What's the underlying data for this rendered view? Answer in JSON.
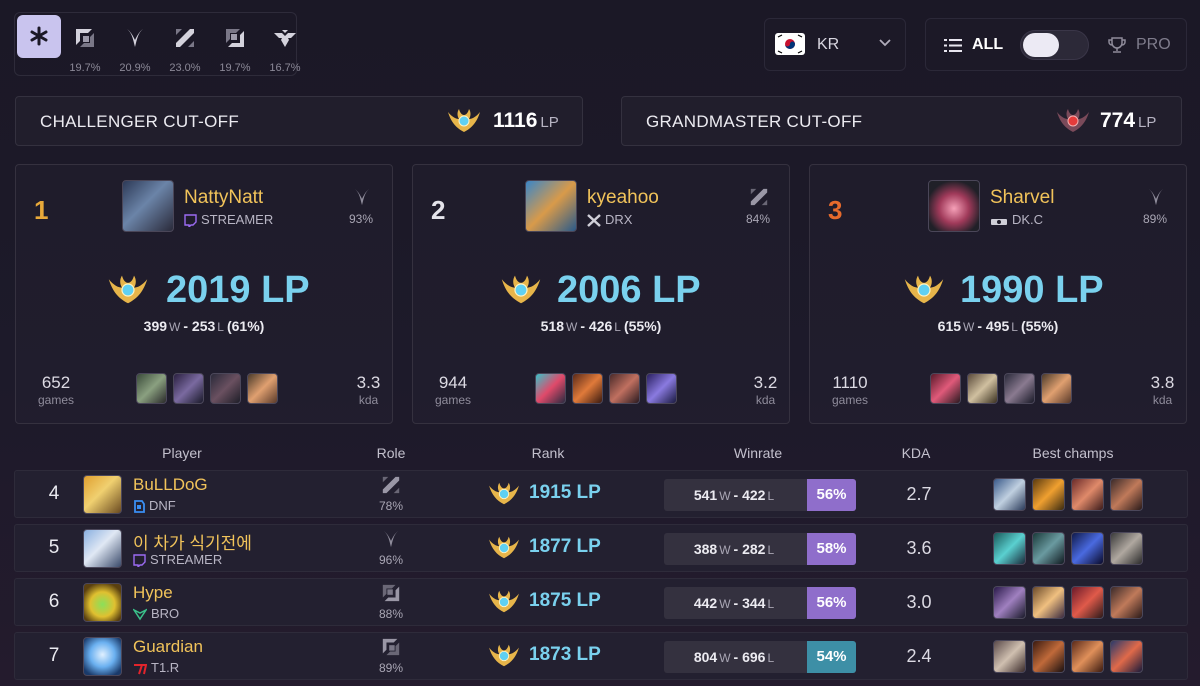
{
  "roles": [
    {
      "icon": "all-roles-icon",
      "pct": ""
    },
    {
      "icon": "top-lane-icon",
      "pct": "19.7%"
    },
    {
      "icon": "jungle-icon",
      "pct": "20.9%"
    },
    {
      "icon": "mid-lane-icon",
      "pct": "23.0%"
    },
    {
      "icon": "bot-lane-icon",
      "pct": "19.7%"
    },
    {
      "icon": "support-icon",
      "pct": "16.7%"
    }
  ],
  "region": {
    "label": "KR"
  },
  "modes": {
    "all": "ALL",
    "pro": "PRO"
  },
  "cutoffs": {
    "challenger": {
      "label": "CHALLENGER CUT-OFF",
      "value": "1116",
      "unit": "LP"
    },
    "grandmaster": {
      "label": "GRANDMASTER CUT-OFF",
      "value": "774",
      "unit": "LP"
    }
  },
  "top3": [
    {
      "rank": "1",
      "name": "NattyNatt",
      "team": "STREAMER",
      "role_pct": "93%",
      "lp": "2019 LP",
      "wins": "399",
      "losses": "253",
      "wr": "(61%)",
      "w": "W",
      "l": "L",
      "games": "652",
      "games_label": "games",
      "kda": "3.3",
      "kda_label": "kda"
    },
    {
      "rank": "2",
      "name": "kyeahoo",
      "team": "DRX",
      "role_pct": "84%",
      "lp": "2006 LP",
      "wins": "518",
      "losses": "426",
      "wr": "(55%)",
      "w": "W",
      "l": "L",
      "games": "944",
      "games_label": "games",
      "kda": "3.2",
      "kda_label": "kda"
    },
    {
      "rank": "3",
      "name": "Sharvel",
      "team": "DK.C",
      "role_pct": "89%",
      "lp": "1990 LP",
      "wins": "615",
      "losses": "495",
      "wr": "(55%)",
      "w": "W",
      "l": "L",
      "games": "1110",
      "games_label": "games",
      "kda": "3.8",
      "kda_label": "kda"
    }
  ],
  "table_headers": {
    "player": "Player",
    "role": "Role",
    "rank": "Rank",
    "winrate": "Winrate",
    "kda": "KDA",
    "best": "Best champs"
  },
  "rows": [
    {
      "num": "4",
      "name": "BuLLDoG",
      "team": "DNF",
      "role_pct": "78%",
      "lp": "1915 LP",
      "wins": "541",
      "losses": "422",
      "w": "W",
      "l": "L",
      "wr": "56%",
      "kda": "2.7"
    },
    {
      "num": "5",
      "name": "이 차가 식기전에",
      "team": "STREAMER",
      "role_pct": "96%",
      "lp": "1877 LP",
      "wins": "388",
      "losses": "282",
      "w": "W",
      "l": "L",
      "wr": "58%",
      "kda": "3.6"
    },
    {
      "num": "6",
      "name": "Hype",
      "team": "BRO",
      "role_pct": "88%",
      "lp": "1875 LP",
      "wins": "442",
      "losses": "344",
      "w": "W",
      "l": "L",
      "wr": "56%",
      "kda": "3.0"
    },
    {
      "num": "7",
      "name": "Guardian",
      "team": "T1.R",
      "role_pct": "89%",
      "lp": "1873 LP",
      "wins": "804",
      "losses": "696",
      "w": "W",
      "l": "L",
      "wr": "54%",
      "kda": "2.4"
    }
  ],
  "colors": {
    "gold": "#f1c35a",
    "lp_blue": "#7ad1ee",
    "wr_purple": "#8f6ecb",
    "wr_teal": "#3d8fa6",
    "rank1": "#e8a93a",
    "rank3": "#e66a2c"
  }
}
